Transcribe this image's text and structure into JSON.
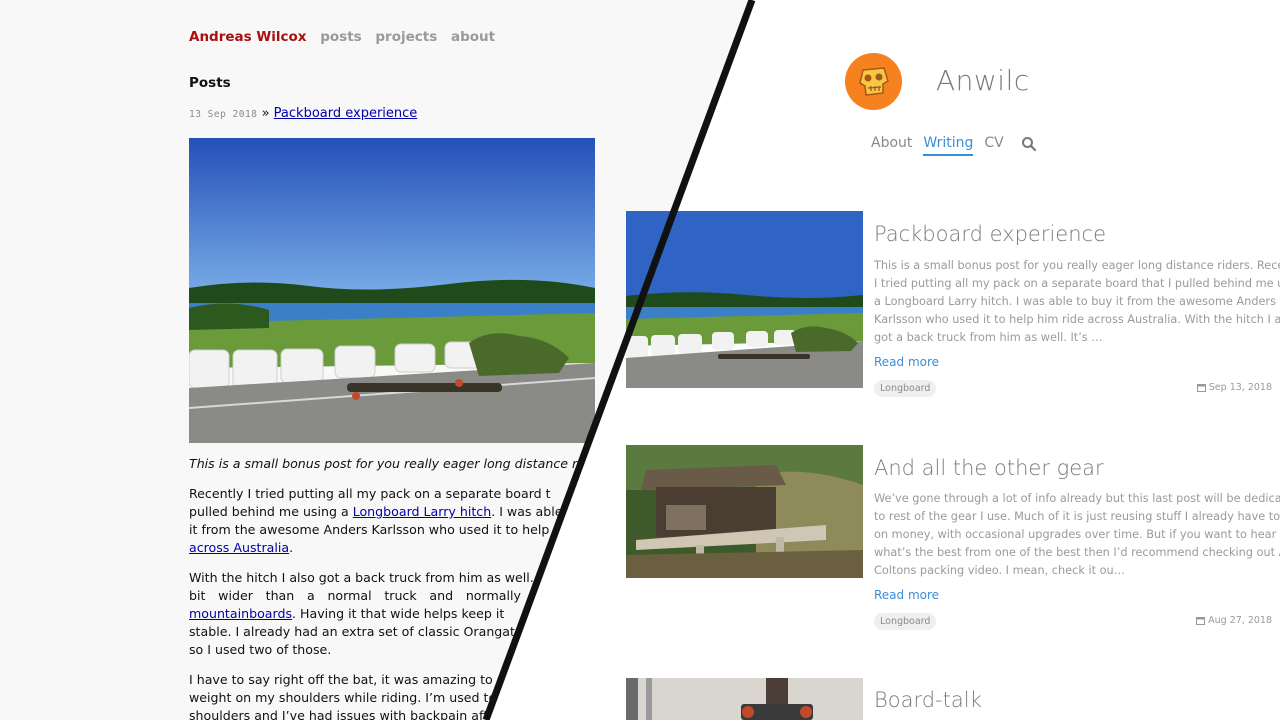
{
  "left": {
    "nav": {
      "brand": "Andreas Wilcox",
      "items": [
        "posts",
        "projects",
        "about"
      ]
    },
    "heading": "Posts",
    "post": {
      "date": "13 Sep 2018",
      "sep": "»",
      "title": "Packboard experience"
    },
    "body": {
      "lede": "This is a small bonus post for you really eager long distance ride",
      "p1_l1": "Recently I tried putting all my pack on a separate board t",
      "p1_l2a": "pulled behind me using a ",
      "p1_l2link": "Longboard Larry hitch",
      "p1_l2b": ". I was able t",
      "p1_l3": "it from the awesome Anders Karlsson who used it to help hi",
      "p1_l4link": "across Australia",
      "p1_l4b": ".",
      "p2_l1": "With the hitch I also got a back truck from him as well. I",
      "p2_l2": [
        "bit",
        "wider",
        "than",
        "a",
        "normal",
        "truck",
        "and",
        "normally"
      ],
      "p2_l3link": "mountainboards",
      "p2_l3b": ". Having it that wide helps keep it",
      "p2_l4": "stable. I already had an extra set of classic Orangat",
      "p2_l5": "so I used two of those.",
      "p3_l1": "I have to say right off the bat, it was amazing to n",
      "p3_l2": "weight on my shoulders while riding. I’m used to",
      "p3_l3": "shoulders and I’ve had issues with backpain after"
    }
  },
  "right": {
    "site_title": "Anwilc",
    "nav": {
      "about": "About",
      "writing": "Writing",
      "cv": "CV"
    },
    "posts": [
      {
        "title": "Packboard experience",
        "excerpt": [
          "This is a small bonus post for you really eager long distance riders. Recently",
          "I tried putting all my pack on a separate board that I pulled behind me using",
          "a Longboard Larry hitch. I was able to buy it from the awesome Anders",
          "Karlsson who used it to help him ride across Australia. With the hitch I also",
          "got a back truck from him as well. It’s …"
        ],
        "read_more": "Read more",
        "tag": "Longboard",
        "date": "Sep 13, 2018"
      },
      {
        "title": "And all the other gear",
        "excerpt": [
          "We’ve gone through a lot of info already but this last post will be dedicated",
          "to rest of the gear I use. Much of it is just reusing stuff I already have to save",
          "on money, with occasional upgrades over time. But if you want to hear",
          "what’s the best from one of the best then I’d recommend checking out Adam",
          "Coltons packing video. I mean, check it ou…"
        ],
        "read_more": "Read more",
        "tag": "Longboard",
        "date": "Aug 27, 2018"
      },
      {
        "title": "Board-talk"
      }
    ]
  },
  "icons": {
    "logo": "skull-logo-icon",
    "search": "search-icon",
    "calendar": "calendar-icon"
  },
  "colors": {
    "accent": "#3a8ed8",
    "brand_red": "#a81010",
    "logo_orange": "#f5821f"
  }
}
